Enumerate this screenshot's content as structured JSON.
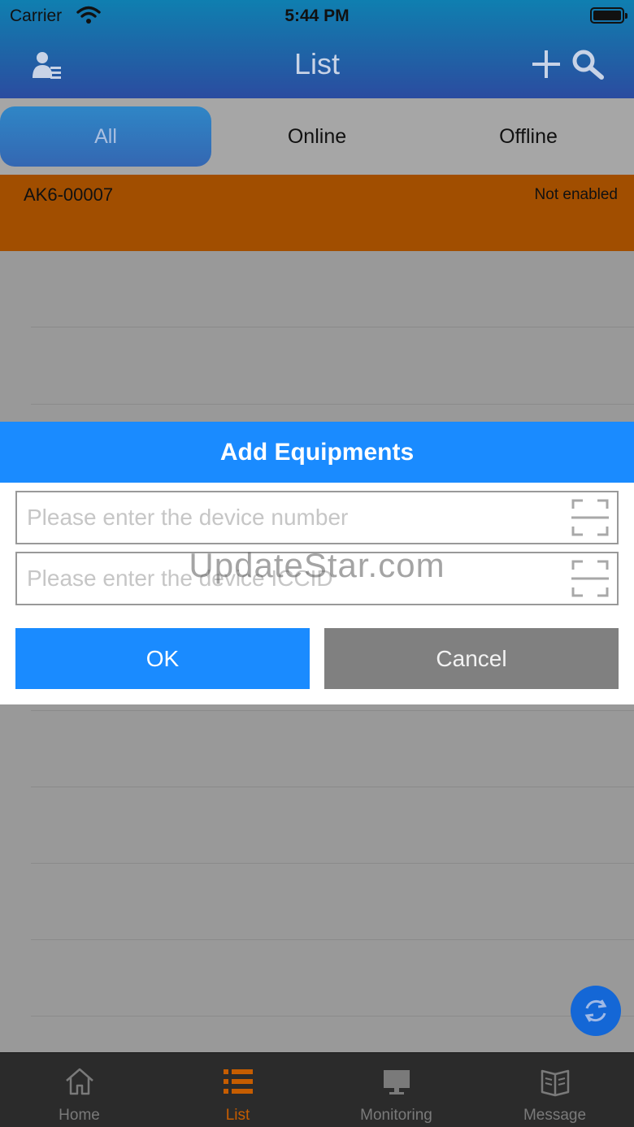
{
  "status_bar": {
    "carrier": "Carrier",
    "time": "5:44 PM"
  },
  "nav": {
    "title": "List"
  },
  "tabs": [
    {
      "label": "All",
      "selected": true
    },
    {
      "label": "Online",
      "selected": false
    },
    {
      "label": "Offline",
      "selected": false
    }
  ],
  "device_list": [
    {
      "id": "AK6-00007",
      "state": "Not enabled",
      "color": "#a14e00"
    }
  ],
  "dialog": {
    "title": "Add Equipments",
    "device_number_placeholder": "Please enter the device number",
    "iccid_placeholder": "Please enter the device ICCID",
    "ok_label": "OK",
    "cancel_label": "Cancel"
  },
  "watermark": "UpdateStar.com",
  "tabbar": {
    "items": [
      {
        "label": "Home",
        "icon": "home-icon"
      },
      {
        "label": "List",
        "icon": "list-icon",
        "active": true
      },
      {
        "label": "Monitoring",
        "icon": "monitor-icon"
      },
      {
        "label": "Message",
        "icon": "message-book-icon"
      }
    ]
  },
  "colors": {
    "accent": "#1a8bff",
    "active_tab": "#c65d00"
  }
}
